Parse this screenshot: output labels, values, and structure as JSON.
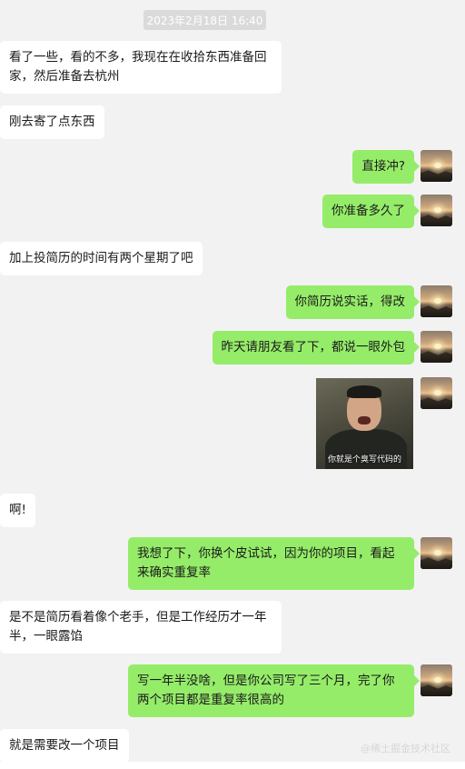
{
  "timestamp": "2023年2月18日 16:40",
  "messages": [
    {
      "side": "left",
      "text": "看了一些，看的不多，我现在在收拾东西准备回家，然后准备去杭州"
    },
    {
      "side": "left",
      "text": "刚去寄了点东西"
    },
    {
      "side": "right",
      "text": "直接冲?"
    },
    {
      "side": "right",
      "text": "你准备多久了"
    },
    {
      "side": "left",
      "text": "加上投简历的时间有两个星期了吧"
    },
    {
      "side": "right",
      "text": "你简历说实话，得改"
    },
    {
      "side": "right",
      "text": "昨天请朋友看了下，都说一眼外包"
    },
    {
      "side": "right",
      "image_caption": "你就是个臭写代码的"
    },
    {
      "side": "left",
      "text": "啊!"
    },
    {
      "side": "right",
      "text": "我想了下，你换个皮试试，因为你的项目，看起来确实重复率"
    },
    {
      "side": "left",
      "text": "是不是简历看着像个老手，但是工作经历才一年半，一眼露馅"
    },
    {
      "side": "right",
      "text": "写一年半没啥，但是你公司写了三个月，完了你两个项目都是重复率很高的"
    },
    {
      "side": "left",
      "text": "就是需要改一个项目"
    }
  ],
  "avatar_icon": "sunset-avatar",
  "watermark": "@稀土掘金技术社区",
  "colors": {
    "background": "#f2f2f2",
    "incoming": "#ffffff",
    "outgoing": "#95ec69"
  }
}
